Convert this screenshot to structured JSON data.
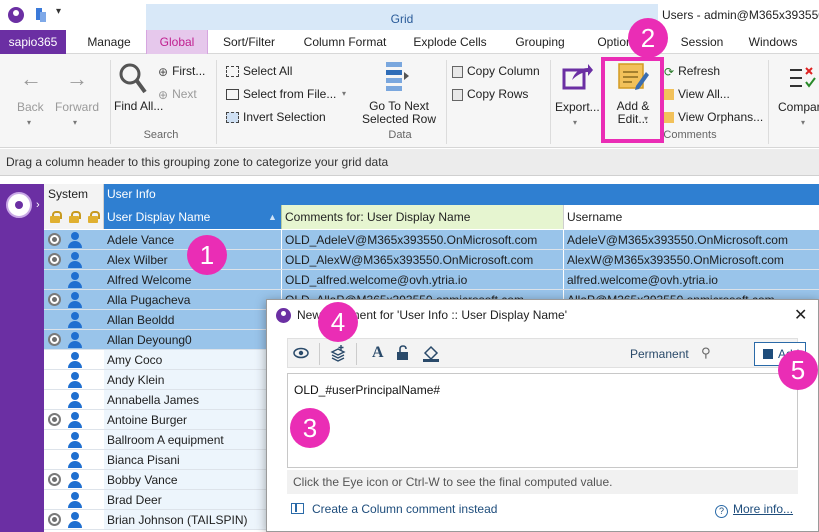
{
  "titlebar": {
    "context_tab": "Grid",
    "window_title": "Users - admin@M365x393550..."
  },
  "tabs": [
    "sapio365",
    "Manage",
    "Global",
    "Sort/Filter",
    "Column Format",
    "Explode Cells",
    "Grouping",
    "Options",
    "Session",
    "Windows"
  ],
  "ribbon": {
    "back": "Back",
    "forward": "Forward",
    "find": "Find All...",
    "first": "First...",
    "next": "Next",
    "search_group": "Search",
    "select_all": "Select All",
    "select_from_file": "Select from File...",
    "invert_selection": "Invert Selection",
    "go_to_next": "Go To Next Selected Row",
    "data_group": "Data",
    "copy_column": "Copy Column",
    "copy_rows": "Copy Rows",
    "export": "Export...",
    "add_edit": "Add & Edit...",
    "refresh": "Refresh",
    "view_all": "View All...",
    "view_orphans": "View Orphans...",
    "comments_group": "Comments",
    "compare": "Compar"
  },
  "groupbar": {
    "text": "Drag a column header to this grouping zone to categorize your grid data"
  },
  "grid": {
    "band_system": "System",
    "band_user_info": "User Info",
    "col_display_name": "User Display Name",
    "col_comments": "Comments for: User Display Name",
    "col_username": "Username",
    "rows": [
      {
        "name": "Adele Vance",
        "comment": "OLD_AdeleV@M365x393550.OnMicrosoft.com",
        "username": "AdeleV@M365x393550.OnMicrosoft.com"
      },
      {
        "name": "Alex Wilber",
        "comment": "OLD_AlexW@M365x393550.OnMicrosoft.com",
        "username": "AlexW@M365x393550.OnMicrosoft.com"
      },
      {
        "name": "Alfred Welcome",
        "comment": "OLD_alfred.welcome@ovh.ytria.io",
        "username": "alfred.welcome@ovh.ytria.io"
      },
      {
        "name": "Alla Pugacheva",
        "comment": "OLD_AllaP@M365x393550.onmicrosoft.com",
        "username": "AllaP@M365x393550.onmicrosoft.com"
      },
      {
        "name": "Allan Beoldd",
        "comment": "",
        "username": ""
      },
      {
        "name": "Allan Deyoung0",
        "comment": "",
        "username": ""
      },
      {
        "name": "Amy Coco",
        "comment": "",
        "username": ""
      },
      {
        "name": "Andy Klein",
        "comment": "",
        "username": ""
      },
      {
        "name": "Annabella James",
        "comment": "",
        "username": ""
      },
      {
        "name": "Antoine Burger",
        "comment": "",
        "username": ""
      },
      {
        "name": "Ballroom A equipment",
        "comment": "",
        "username": ""
      },
      {
        "name": "Bianca Pisani",
        "comment": "",
        "username": ""
      },
      {
        "name": "Bobby Vance",
        "comment": "",
        "username": ""
      },
      {
        "name": "Brad Deer",
        "comment": "",
        "username": ""
      },
      {
        "name": "Brian Johnson (TAILSPIN)",
        "comment": "",
        "username": ""
      }
    ]
  },
  "dialog": {
    "title": "New Comment for 'User Info :: User Display Name'",
    "permanent": "Permanent",
    "add": "Add",
    "value": "OLD_#userPrincipalName#",
    "hint": "Click the Eye icon or Ctrl-W to see the final computed value.",
    "create_column_comment": "Create a Column comment instead",
    "more_info": "More info..."
  },
  "badges": [
    "1",
    "2",
    "3",
    "4",
    "5"
  ],
  "colors": {
    "accent_purple": "#6b2fa3",
    "highlight_pink": "#ea2db5",
    "selection_blue": "#99c4ea",
    "header_blue": "#2f7fd1",
    "comment_header_green": "#e6f5d0"
  }
}
